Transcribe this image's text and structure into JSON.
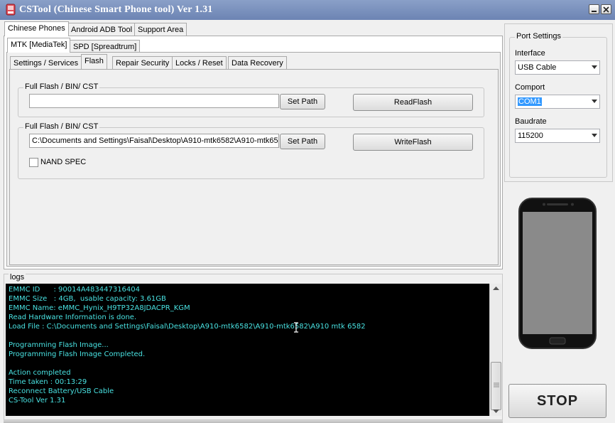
{
  "window": {
    "title": "CSTool (Chinese Smart Phone tool)  Ver 1.31",
    "controls": {
      "minimize_icon": "minimize-icon",
      "close_icon": "close-icon"
    }
  },
  "main_tabs": [
    "Chinese Phones",
    "Android ADB Tool",
    "Support Area"
  ],
  "chip_tabs": [
    "MTK [MediaTek]",
    "SPD [Spreadtrum]"
  ],
  "function_tabs": [
    "Settings / Services",
    "Flash",
    "Repair Security",
    "Locks / Reset",
    "Data Recovery"
  ],
  "read_group": {
    "title": "Full Flash / BIN/ CST",
    "path_value": "",
    "set_path_label": "Set Path",
    "action_label": "ReadFlash"
  },
  "write_group": {
    "title": "Full Flash / BIN/ CST",
    "path_value": "C:\\Documents and Settings\\Faisal\\Desktop\\A910-mtk6582\\A910-mtk658",
    "set_path_label": "Set Path",
    "action_label": "WriteFlash",
    "nand_spec_label": "NAND SPEC",
    "nand_spec_checked": false
  },
  "port_settings": {
    "title": "Port Settings",
    "interface_label": "Interface",
    "interface_value": "USB Cable",
    "comport_label": "Comport",
    "comport_value": "COM1",
    "baudrate_label": "Baudrate",
    "baudrate_value": "115200"
  },
  "logs": {
    "title": "logs",
    "lines": [
      "EMMC ID      : 90014A483447316404",
      "EMMC Size   : 4GB,  usable capacity: 3.61GB",
      "EMMC Name: eMMC_Hynix_H9TP32A8JDACPR_KGM",
      "Read Hardware Information is done.",
      "Load File : C:\\Documents and Settings\\Faisal\\Desktop\\A910-mtk6582\\A910-mtk6582\\A910 mtk 6582",
      "",
      "Programming Flash Image...",
      "Programming Flash Image Completed.",
      "",
      "Action completed",
      "Time taken : 00:13:29",
      "Reconnect Battery/USB Cable",
      "CS-Tool Ver 1.31"
    ]
  },
  "stop_label": "STOP",
  "colors": {
    "log_text": "#49e2e2",
    "log_bg": "#000000",
    "selection": "#3399ff",
    "titlebar": "#7a90bd"
  }
}
